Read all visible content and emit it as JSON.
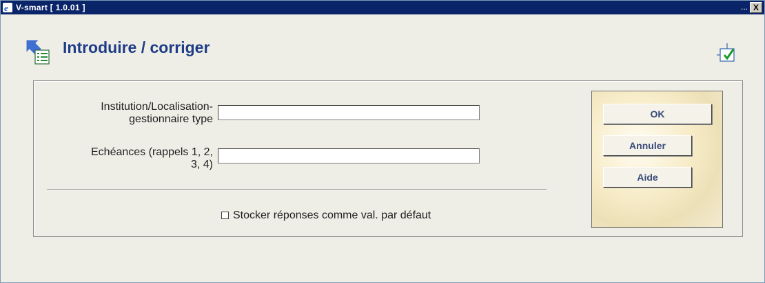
{
  "window": {
    "title": "V-smart [ 1.0.01 ]",
    "dots": "...",
    "close_label": "X"
  },
  "header": {
    "title": "Introduire / corriger",
    "icon": "arrow-list-icon",
    "corner_icon": "layout-check-icon"
  },
  "form": {
    "fields": [
      {
        "label_line1": "Institution/Localisation-",
        "label_line2": "gestionnaire type",
        "value": ""
      },
      {
        "label_line1": "Echéances (rappels 1, 2,",
        "label_line2": "3, 4)",
        "value": ""
      }
    ],
    "checkbox_label": "Stocker réponses comme val. par défaut",
    "checkbox_checked": false
  },
  "buttons": {
    "ok": "OK",
    "cancel": "Annuler",
    "help": "Aide"
  }
}
